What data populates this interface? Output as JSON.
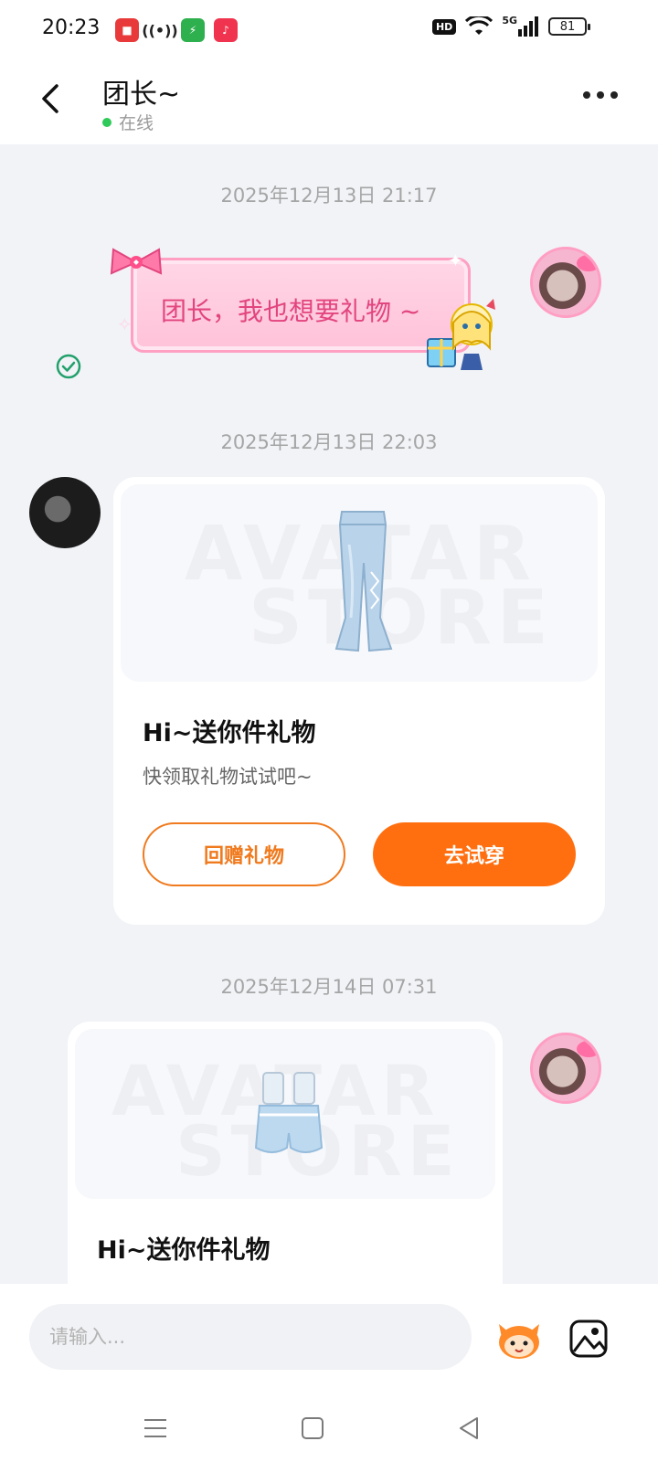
{
  "status_bar": {
    "time": "20:23",
    "hd": "HD",
    "network": "5G",
    "battery": "81"
  },
  "header": {
    "title": "团长~",
    "status": "在线"
  },
  "messages": [
    {
      "type": "timestamp",
      "text": "2025年12月13日 21:17"
    },
    {
      "type": "sticker_text",
      "from": "self",
      "text": "团长，我也想要礼物 ~",
      "read": true
    },
    {
      "type": "timestamp",
      "text": "2025年12月13日 22:03"
    },
    {
      "type": "gift_card",
      "from": "other",
      "item": "jeans",
      "title": "Hi~送你件礼物",
      "subtitle": "快领取礼物试试吧~",
      "btn_return": "回赠礼物",
      "btn_try": "去试穿"
    },
    {
      "type": "timestamp",
      "text": "2025年12月14日 07:31"
    },
    {
      "type": "gift_card",
      "from": "self",
      "item": "shorts",
      "title": "Hi~送你件礼物"
    }
  ],
  "watermark": {
    "line1": "AVATAR",
    "line2": "STORE"
  },
  "input": {
    "placeholder": "请输入..."
  },
  "colors": {
    "accent": "#ff6f0f",
    "pink_text": "#e2457e",
    "online": "#2fca5a"
  },
  "icons": [
    "back-arrow-icon",
    "more-icon",
    "check-circle-icon",
    "mascot-icon",
    "image-icon",
    "menu-icon",
    "home-icon",
    "nav-back-icon"
  ]
}
